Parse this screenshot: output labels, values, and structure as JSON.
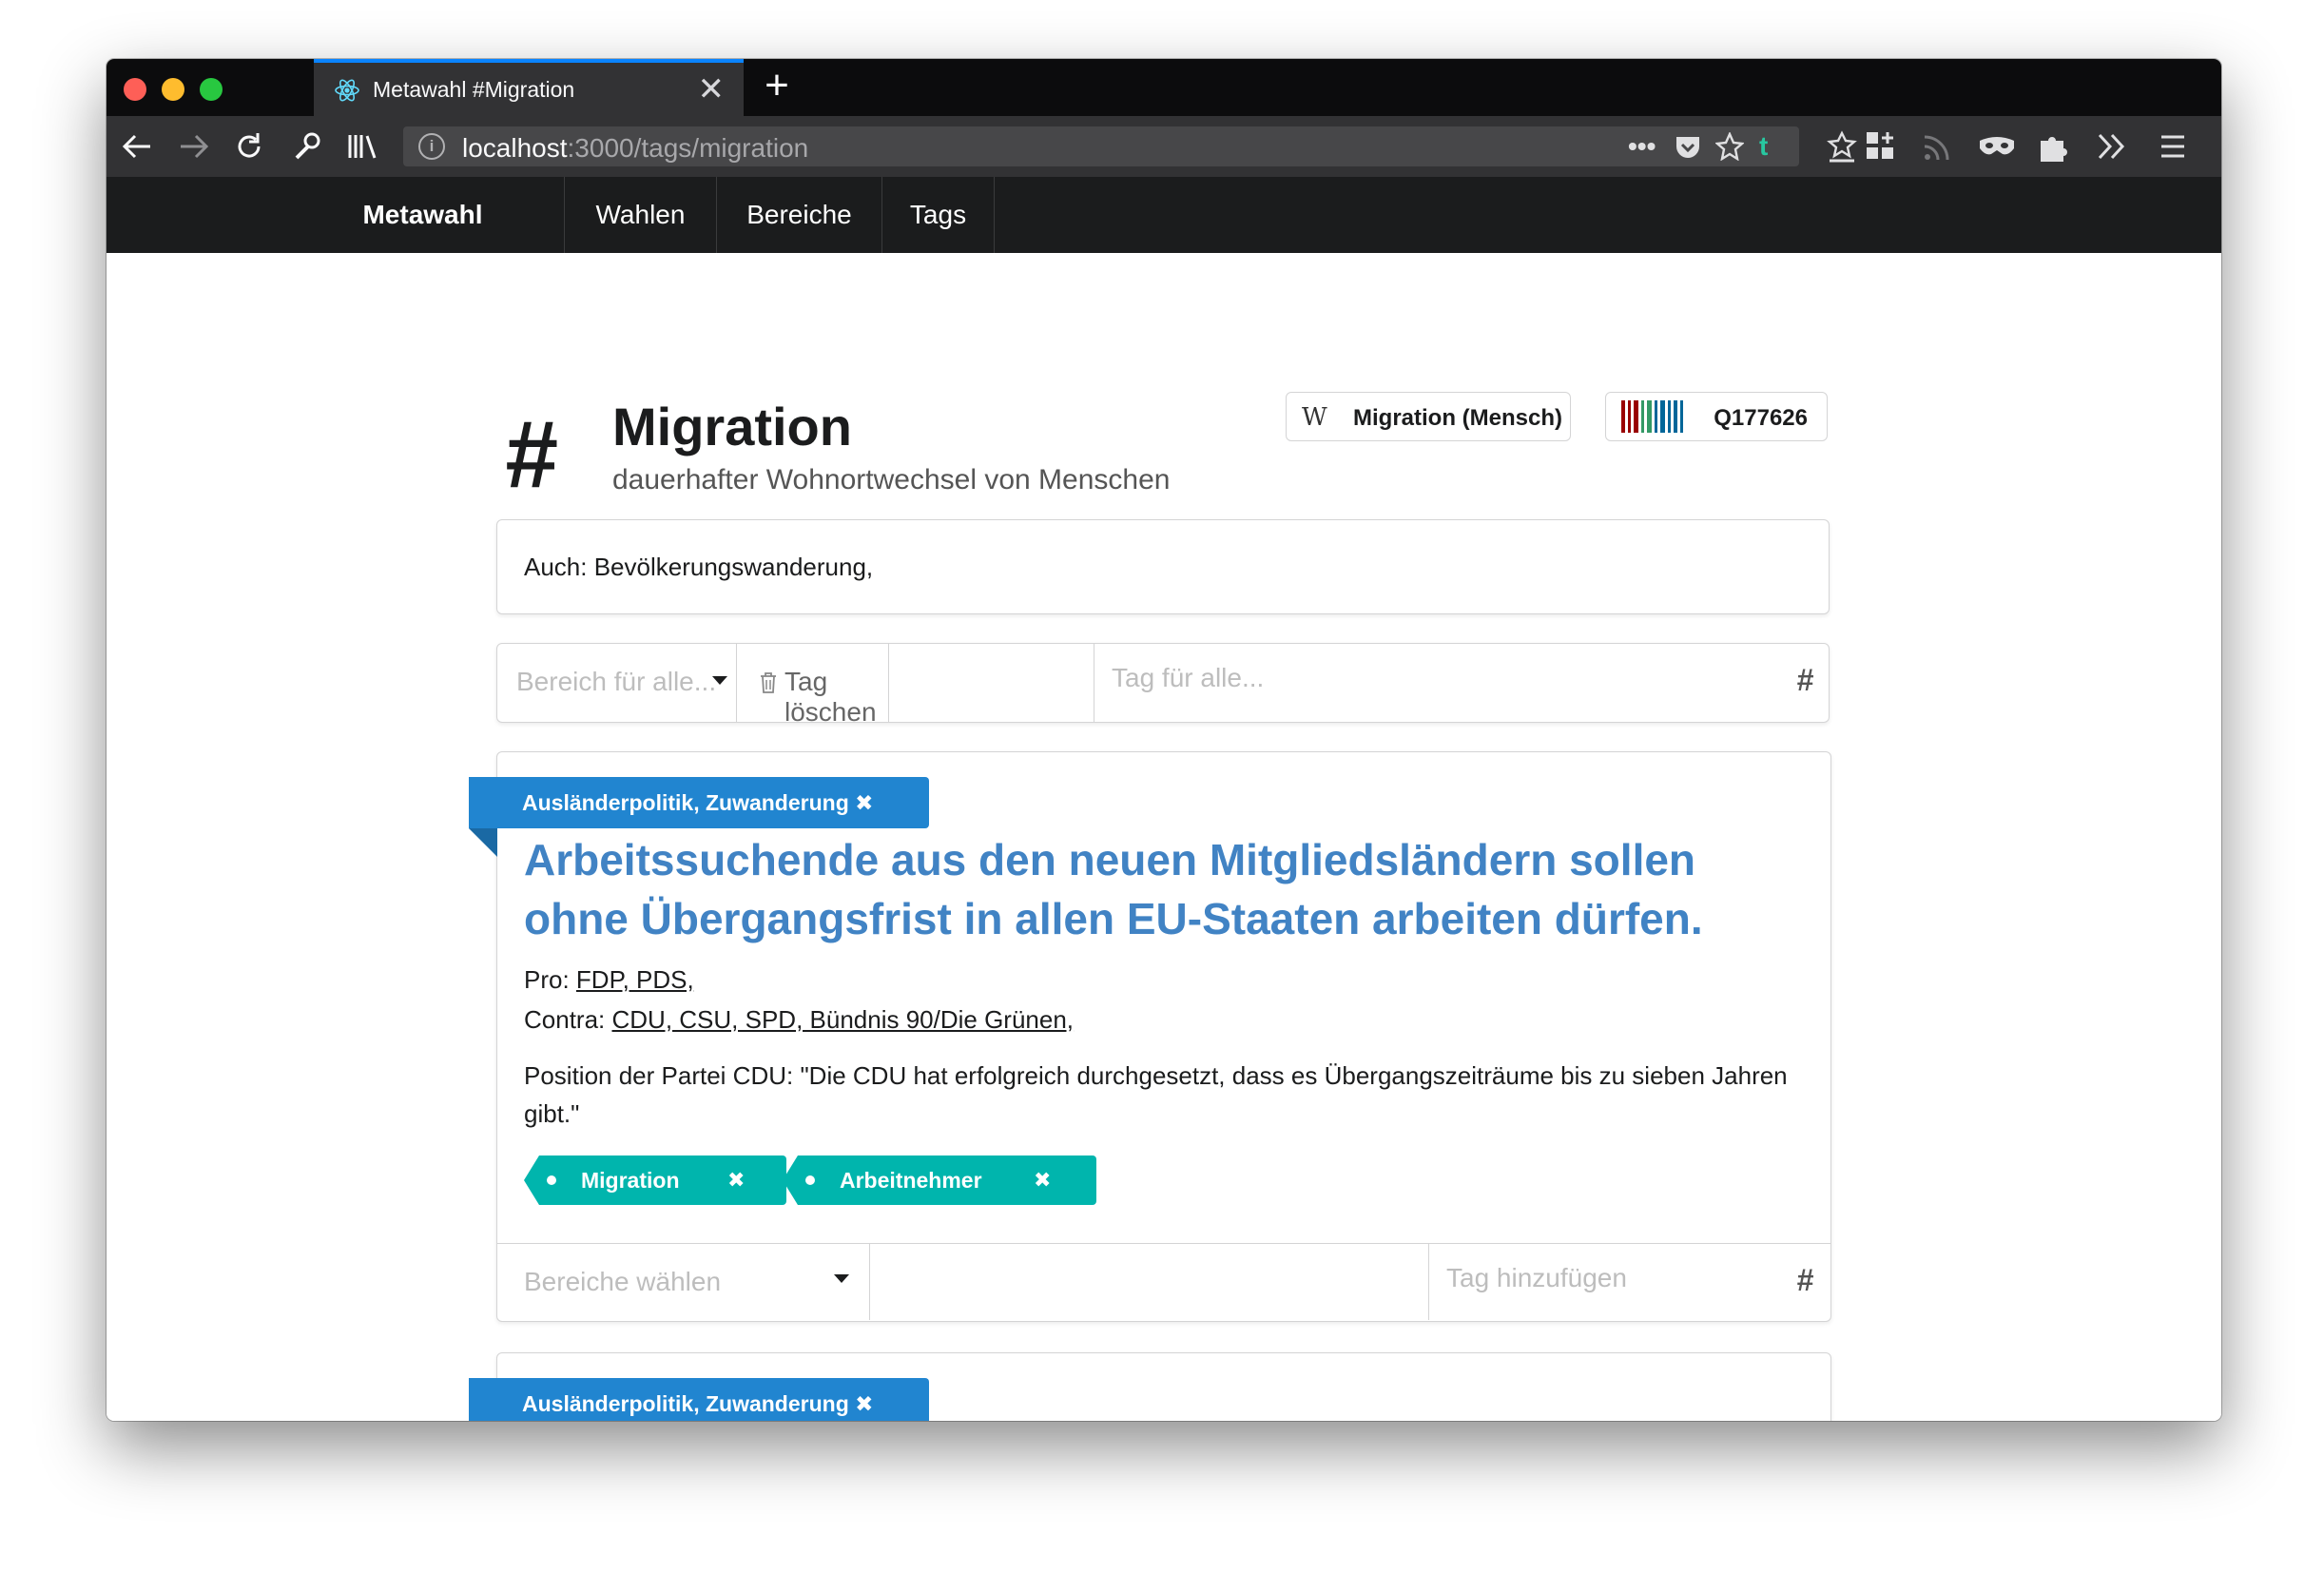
{
  "browser": {
    "tab_title": "Metawahl #Migration",
    "tab_close": "✕",
    "new_tab": "+",
    "url_host": "localhost",
    "url_rest": ":3000/tags/migration",
    "page_actions": "•••",
    "extension_t": "t"
  },
  "site_nav": {
    "brand": "Metawahl",
    "items": [
      "Wahlen",
      "Bereiche",
      "Tags"
    ]
  },
  "tag": {
    "title": "Migration",
    "description": "dauerhafter Wohnortwechsel von Menschen",
    "wikipedia_label": "Migration (Mensch)",
    "wikidata_id": "Q177626",
    "aliases": "Auch: Bevölkerungswanderung,"
  },
  "toolbar": {
    "category_placeholder": "Bereich für alle...",
    "delete_label": "Tag löschen",
    "tag_placeholder": "Tag für alle..."
  },
  "theses": [
    {
      "category": "Ausländerpolitik, Zuwanderung",
      "title": "Arbeitssuchende aus den neuen Mitgliedsländern sollen ohne Übergangsfrist in allen EU-Staaten arbeiten dürfen.",
      "pro_label": "Pro:",
      "pro_parties": "FDP, PDS,",
      "contra_label": "Contra:",
      "contra_parties": "CDU, CSU, SPD, Bündnis 90/Die Grünen,",
      "position": "Position der Partei CDU: \"Die CDU hat erfolgreich durchgesetzt, dass es Übergangszeiträume bis zu sieben Jahren gibt.\"",
      "tags": [
        "Migration",
        "Arbeitnehmer"
      ],
      "category_select_placeholder": "Bereiche wählen",
      "tag_add_placeholder": "Tag hinzufügen"
    },
    {
      "category": "Ausländerpolitik, Zuwanderung"
    }
  ],
  "colors": {
    "accent_blue": "#2185d0",
    "title_blue": "#4183c4",
    "teal": "#00b5ad",
    "navbar": "#1b1c1d"
  }
}
